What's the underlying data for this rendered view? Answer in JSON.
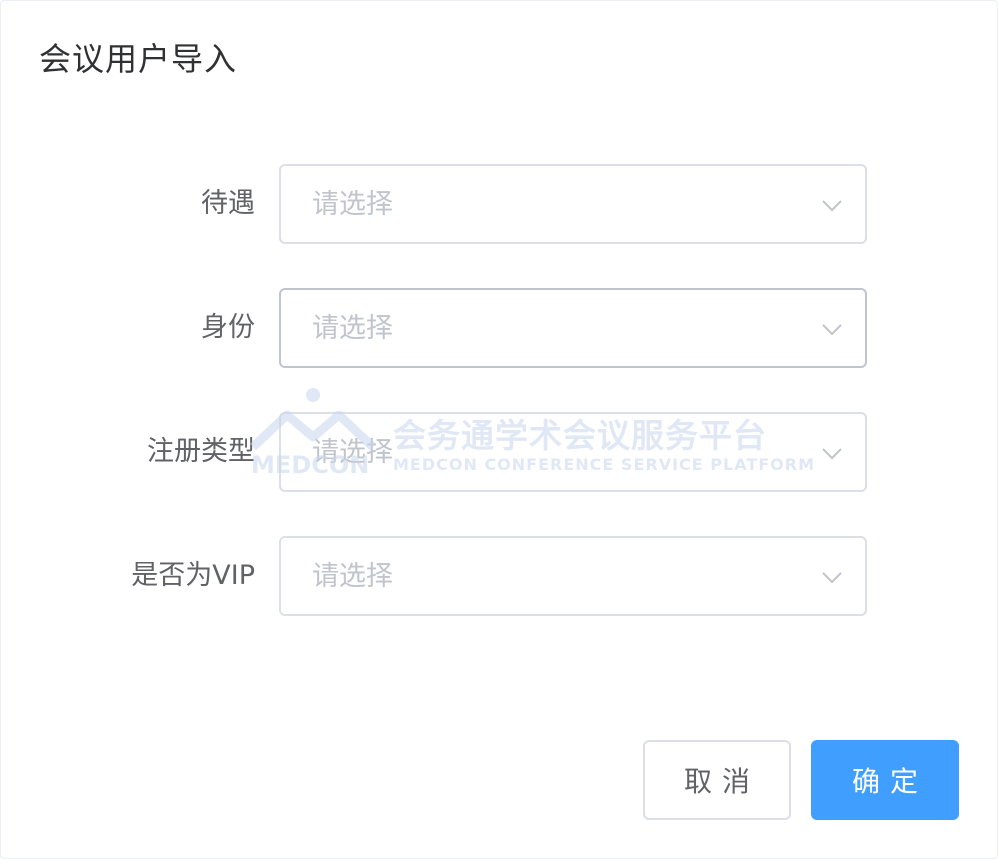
{
  "dialog": {
    "title": "会议用户导入"
  },
  "form": {
    "fields": [
      {
        "label": "待遇",
        "placeholder": "请选择"
      },
      {
        "label": "身份",
        "placeholder": "请选择"
      },
      {
        "label": "注册类型",
        "placeholder": "请选择"
      },
      {
        "label": "是否为VIP",
        "placeholder": "请选择"
      }
    ]
  },
  "footer": {
    "cancel_label": "取消",
    "confirm_label": "确定"
  },
  "watermark": {
    "brand": "MEDCON",
    "title_cn": "会务通学术会议服务平台",
    "title_en": "MEDCON CONFERENCE SERVICE PLATFORM"
  },
  "icons": {
    "select_arrow": "chevron-down-icon"
  },
  "colors": {
    "primary": "#409eff",
    "border": "#dcdfe6",
    "placeholder": "#c0c4cc",
    "text": "#606266"
  }
}
